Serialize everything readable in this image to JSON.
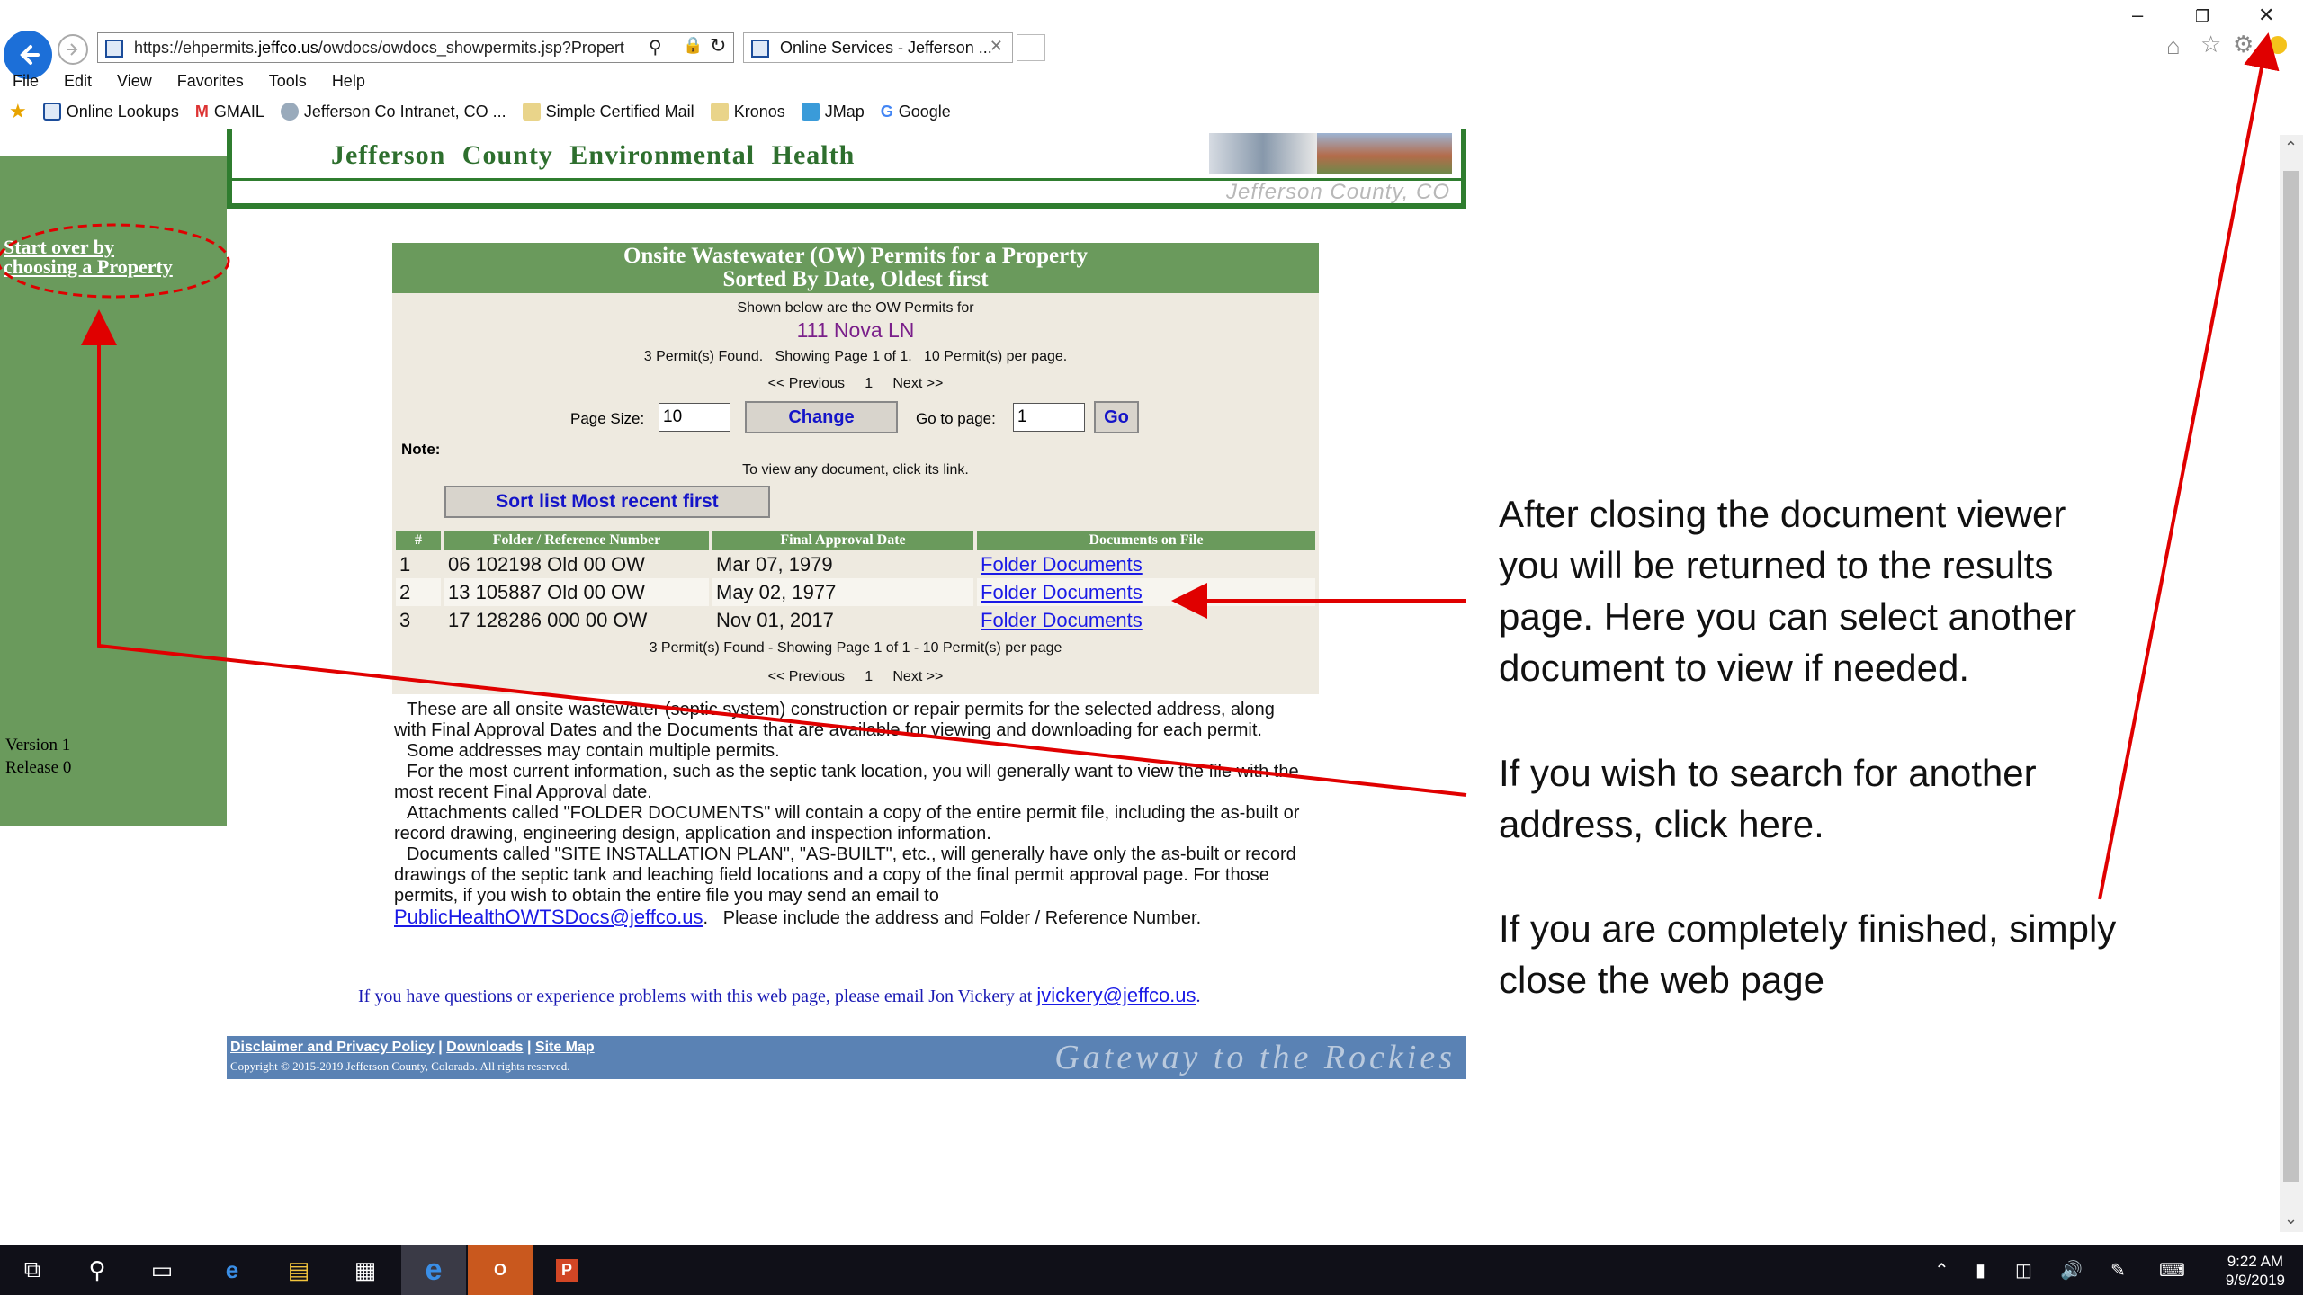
{
  "browser": {
    "url_prefix": "https://ehpermits.",
    "url_domain": "jeffco.us",
    "url_rest": "/owdocs/owdocs_showpermits.jsp?Propert",
    "tab_title": "Online Services - Jefferson ...",
    "menu": [
      "File",
      "Edit",
      "View",
      "Favorites",
      "Tools",
      "Help"
    ],
    "favorites": [
      "Online Lookups",
      "GMAIL",
      "Jefferson Co Intranet, CO ...",
      "Simple Certified Mail",
      "Kronos",
      "JMap",
      "Google"
    ]
  },
  "banner": {
    "title": "Jefferson County Environmental Health",
    "subtitle": "Jefferson County, CO"
  },
  "sidebar": {
    "start_over_line1": "Start over by",
    "start_over_line2": "choosing a Property",
    "version": "Version 1",
    "release": "Release 0"
  },
  "panel": {
    "heading_line1": "Onsite Wastewater (OW) Permits for a Property",
    "heading_line2": "Sorted By Date, Oldest first",
    "shown_below": "Shown below are the OW Permits for",
    "address": "111 Nova LN",
    "found_summary": "3 Permit(s) Found.   Showing Page 1 of 1.   10 Permit(s) per page.",
    "pager_prev": "<< Previous",
    "pager_page": "1",
    "pager_next": "Next >>",
    "page_size_label": "Page Size:",
    "page_size_value": "10",
    "change_label": "Change",
    "goto_label": "Go to page:",
    "goto_value": "1",
    "go_label": "Go",
    "note_label": "Note:",
    "view_hint": "To view any document, click its link.",
    "sort_label": "Sort list Most recent first",
    "columns": [
      "#",
      "Folder / Reference Number",
      "Final Approval Date",
      "Documents on File"
    ],
    "rows": [
      {
        "num": "1",
        "folder": "06 102198 Old 00 OW",
        "date": "Mar 07, 1979",
        "docs": "Folder Documents"
      },
      {
        "num": "2",
        "folder": "13 105887 Old 00 OW",
        "date": "May 02, 1977",
        "docs": "Folder Documents"
      },
      {
        "num": "3",
        "folder": "17 128286 000 00 OW",
        "date": "Nov 01, 2017",
        "docs": "Folder Documents"
      }
    ],
    "footer_summary": "3 Permit(s) Found - Showing Page 1 of 1 - 10 Permit(s) per page"
  },
  "notes": {
    "p1": "These are all onsite wastewater (septic system) construction or repair permits for the selected address, along with Final Approval Dates and the Documents that are available for viewing and downloading for each permit.",
    "p2": "Some addresses may contain multiple permits.",
    "p3": "For the most current information, such as the septic tank location, you will generally want to view the file with the most recent Final Approval date.",
    "p4": "Attachments called \"FOLDER DOCUMENTS\" will contain a copy of the entire permit file, including the as-built or record drawing, engineering design, application and inspection information.",
    "p5": "Documents called \"SITE INSTALLATION PLAN\", \"AS-BUILT\", etc., will generally have only the as-built or record drawings of the septic tank and leaching field locations and a copy of the final permit approval page. For those permits, if you wish to obtain the entire file you may send an email to",
    "email": "PublicHealthOWTSDocs@jeffco.us",
    "p5_tail": ".   Please include the address and Folder / Reference Number."
  },
  "contact": {
    "text": "If you have questions or experience problems with this web page, please email Jon Vickery at",
    "email": "jvickery@jeffco.us",
    "tail": "."
  },
  "footer": {
    "link1": "Disclaimer and Privacy Policy",
    "link2": "Downloads",
    "link3": "Site Map",
    "copyright": "Copyright © 2015-2019   Jefferson County, Colorado. All rights reserved.",
    "motto": "Gateway to the Rockies"
  },
  "callouts": {
    "results_line1": "After closing the document viewer",
    "results_line2": "you will be returned to the results",
    "results_line3": "page. Here you can select another",
    "results_line4": "document to view if needed.",
    "search_line1": "If you wish to search for another",
    "search_line2": "address, click here.",
    "close_line1": "If you are completely finished, simply",
    "close_line2": "close the web page"
  },
  "taskbar": {
    "time": "9:22 AM",
    "date": "9/9/2019"
  },
  "colors": {
    "green": "#6a9a5c",
    "link_blue": "#1a1ae6",
    "arrow_red": "#e00000",
    "footer_blue": "#5a82b4"
  }
}
